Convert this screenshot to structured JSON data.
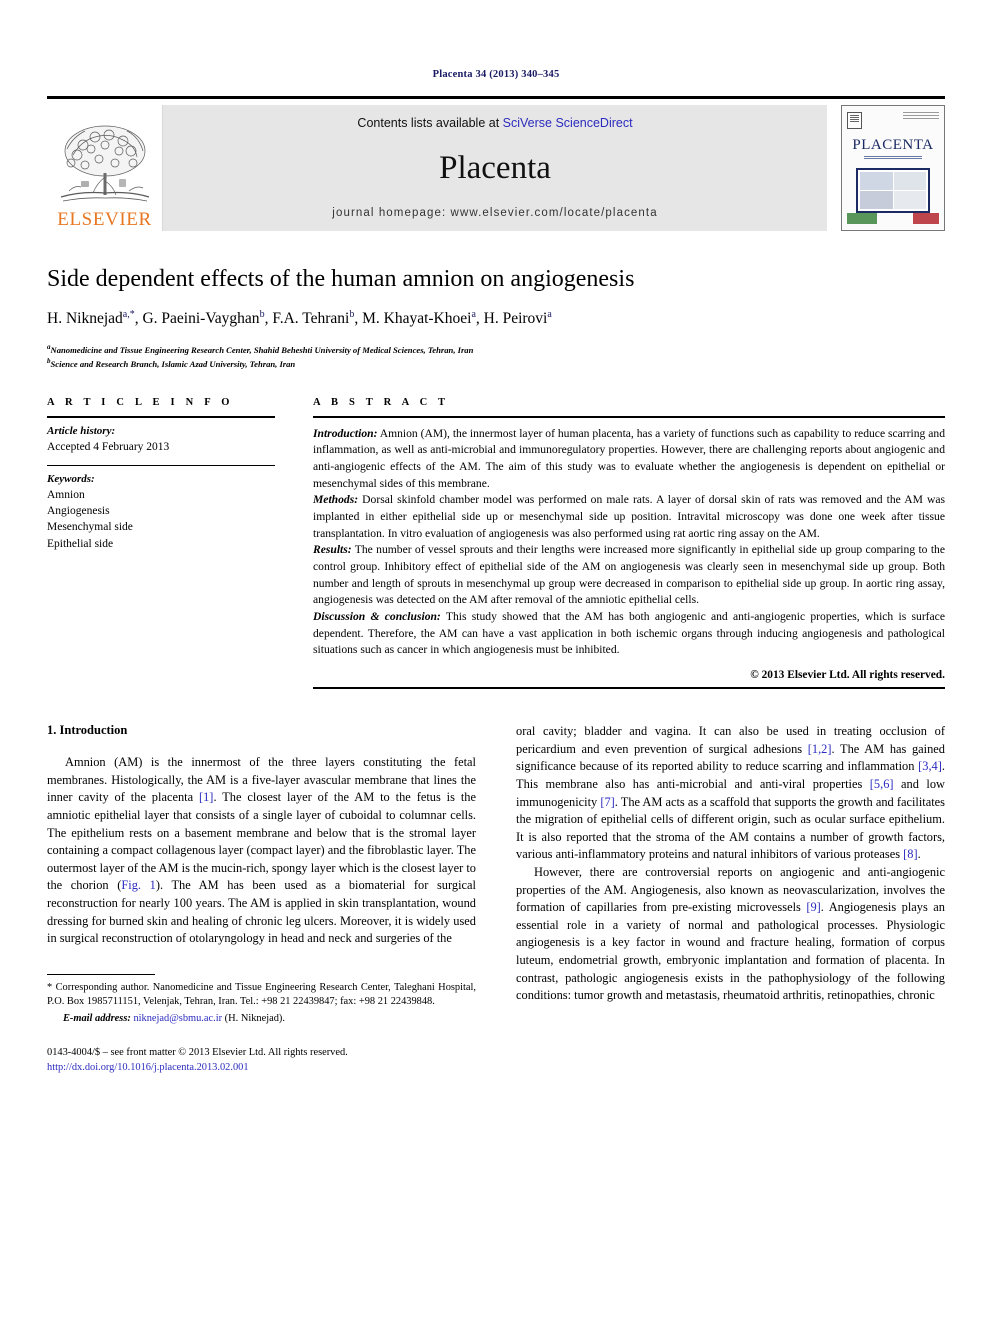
{
  "running_head": "Placenta 34 (2013) 340–345",
  "masthead": {
    "publisher_wordmark": "ELSEVIER",
    "contents_prefix": "Contents lists available at",
    "contents_link": "SciVerse ScienceDirect",
    "journal_name": "Placenta",
    "homepage": "journal homepage: www.elsevier.com/locate/placenta",
    "cover_title": "PLACENTA",
    "link_color": "#2b2bbf",
    "wordmark_color": "#e87722",
    "band_color": "#e6e6e6"
  },
  "article": {
    "title": "Side dependent effects of the human amnion on angiogenesis",
    "authors_html": "H. Niknejad a,*, G. Paeini-Vayghan b, F.A. Tehrani b, M. Khayat-Khoei a, H. Peirovi a",
    "authors": [
      {
        "name": "H. Niknejad",
        "marks": "a,*"
      },
      {
        "name": "G. Paeini-Vayghan",
        "marks": "b"
      },
      {
        "name": "F.A. Tehrani",
        "marks": "b"
      },
      {
        "name": "M. Khayat-Khoei",
        "marks": "a"
      },
      {
        "name": "H. Peirovi",
        "marks": "a"
      }
    ],
    "affiliations": [
      {
        "mark": "a",
        "text": "Nanomedicine and Tissue Engineering Research Center, Shahid Beheshti University of Medical Sciences, Tehran, Iran"
      },
      {
        "mark": "b",
        "text": "Science and Research Branch, Islamic Azad University, Tehran, Iran"
      }
    ]
  },
  "article_info": {
    "heading": "A R T I C L E   I N F O",
    "history_label": "Article history:",
    "history_value": "Accepted 4 February 2013",
    "keywords_label": "Keywords:",
    "keywords": [
      "Amnion",
      "Angiogenesis",
      "Mesenchymal side",
      "Epithelial side"
    ]
  },
  "abstract": {
    "heading": "A B S T R A C T",
    "sections": [
      {
        "lead": "Introduction:",
        "text": " Amnion (AM), the innermost layer of human placenta, has a variety of functions such as capability to reduce scarring and inflammation, as well as anti-microbial and immunoregulatory properties. However, there are challenging reports about angiogenic and anti-angiogenic effects of the AM. The aim of this study was to evaluate whether the angiogenesis is dependent on epithelial or mesenchymal sides of this membrane."
      },
      {
        "lead": "Methods:",
        "text": " Dorsal skinfold chamber model was performed on male rats. A layer of dorsal skin of rats was removed and the AM was implanted in either epithelial side up or mesenchymal side up position. Intravital microscopy was done one week after tissue transplantation. In vitro evaluation of angiogenesis was also performed using rat aortic ring assay on the AM."
      },
      {
        "lead": "Results:",
        "text": " The number of vessel sprouts and their lengths were increased more significantly in epithelial side up group comparing to the control group. Inhibitory effect of epithelial side of the AM on angiogenesis was clearly seen in mesenchymal side up group. Both number and length of sprouts in mesenchymal up group were decreased in comparison to epithelial side up group. In aortic ring assay, angiogenesis was detected on the AM after removal of the amniotic epithelial cells."
      },
      {
        "lead": "Discussion & conclusion:",
        "text": " This study showed that the AM has both angiogenic and anti-angiogenic properties, which is surface dependent. Therefore, the AM can have a vast application in both ischemic organs through inducing angiogenesis and pathological situations such as cancer in which angiogenesis must be inhibited."
      }
    ],
    "copyright": "© 2013 Elsevier Ltd. All rights reserved."
  },
  "body": {
    "section_heading": "1. Introduction",
    "left_column": [
      {
        "segments": [
          {
            "t": "Amnion (AM) is the innermost of the three layers constituting the fetal membranes. Histologically, the AM is a five-layer avascular membrane that lines the inner cavity of the placenta ",
            "link": false
          },
          {
            "t": "[1]",
            "link": true
          },
          {
            "t": ". The closest layer of the AM to the fetus is the amniotic epithelial layer that consists of a single layer of cuboidal to columnar cells. The epithelium rests on a basement membrane and below that is the stromal layer containing a compact collagenous layer (compact layer) and the fibroblastic layer. The outermost layer of the AM is the mucin-rich, spongy layer which is the closest layer to the chorion (",
            "link": false
          },
          {
            "t": "Fig. 1",
            "link": true
          },
          {
            "t": "). The AM has been used as a biomaterial for surgical reconstruction for nearly 100 years. The AM is applied in skin transplantation, wound dressing for burned skin and healing of chronic leg ulcers. Moreover, it is widely used in surgical reconstruction of otolaryngology in head and neck and surgeries of the",
            "link": false
          }
        ]
      }
    ],
    "right_column": [
      {
        "segments": [
          {
            "t": "oral cavity; bladder and vagina. It can also be used in treating occlusion of pericardium and even prevention of surgical adhesions ",
            "link": false
          },
          {
            "t": "[1,2]",
            "link": true
          },
          {
            "t": ". The AM has gained significance because of its reported ability to reduce scarring and inflammation ",
            "link": false
          },
          {
            "t": "[3,4]",
            "link": true
          },
          {
            "t": ". This membrane also has anti-microbial and anti-viral properties ",
            "link": false
          },
          {
            "t": "[5,6]",
            "link": true
          },
          {
            "t": " and low immunogenicity ",
            "link": false
          },
          {
            "t": "[7]",
            "link": true
          },
          {
            "t": ". The AM acts as a scaffold that supports the growth and facilitates the migration of epithelial cells of different origin, such as ocular surface epithelium. It is also reported that the stroma of the AM contains a number of growth factors, various anti-inflammatory proteins and natural inhibitors of various proteases ",
            "link": false
          },
          {
            "t": "[8]",
            "link": true
          },
          {
            "t": ".",
            "link": false
          }
        ],
        "indent": false
      },
      {
        "segments": [
          {
            "t": "However, there are controversial reports on angiogenic and anti-angiogenic properties of the AM. Angiogenesis, also known as neovascularization, involves the formation of capillaries from pre-existing microvessels ",
            "link": false
          },
          {
            "t": "[9]",
            "link": true
          },
          {
            "t": ". Angiogenesis plays an essential role in a variety of normal and pathological processes. Physiologic angiogenesis is a key factor in wound and fracture healing, formation of corpus luteum, endometrial growth, embryonic implantation and formation of placenta. In contrast, pathologic angiogenesis exists in the pathophysiology of the following conditions: tumor growth and metastasis, rheumatoid arthritis, retinopathies, chronic",
            "link": false
          }
        ],
        "indent": true
      }
    ]
  },
  "footnote": {
    "corresponding": "* Corresponding author. Nanomedicine and Tissue Engineering Research Center, Taleghani Hospital, P.O. Box 1985711151, Velenjak, Tehran, Iran. Tel.: +98 21 22439847; fax: +98 21 22439848.",
    "email_label": "E-mail address:",
    "email": "niknejad@sbmu.ac.ir",
    "email_suffix": " (H. Niknejad)."
  },
  "imprint": {
    "issn_line": "0143-4004/$ – see front matter © 2013 Elsevier Ltd. All rights reserved.",
    "doi": "http://dx.doi.org/10.1016/j.placenta.2013.02.001"
  }
}
